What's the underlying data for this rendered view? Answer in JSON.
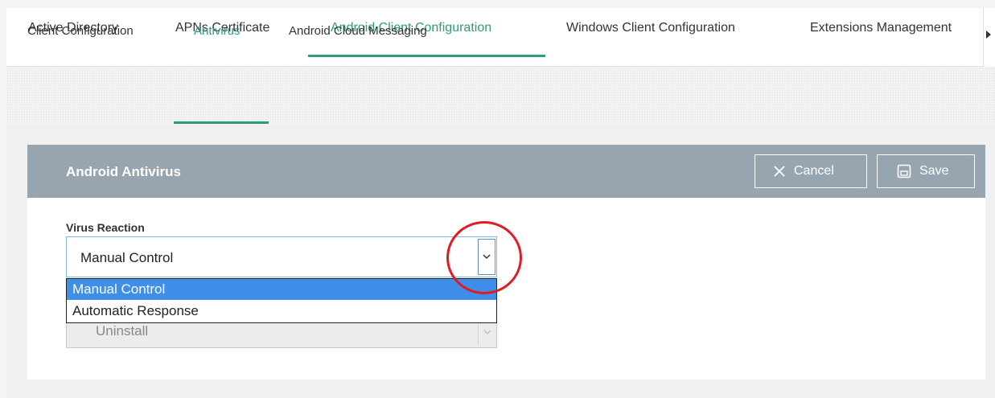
{
  "top_tabs": [
    {
      "label": "Active Directory"
    },
    {
      "label": "APNs Certificate"
    },
    {
      "label": "Android Client Configuration"
    },
    {
      "label": "Windows Client Configuration"
    },
    {
      "label": "Extensions Management"
    }
  ],
  "sub_tabs": [
    {
      "label": "Client Configuration"
    },
    {
      "label": "Antivirus"
    },
    {
      "label": "Android Cloud Messaging"
    }
  ],
  "panel": {
    "title": "Android Antivirus",
    "cancel_label": "Cancel",
    "save_label": "Save",
    "field_label": "Virus Reaction",
    "selected_value": "Manual Control",
    "options": [
      "Manual Control",
      "Automatic Response"
    ],
    "second_select_value": "Uninstall"
  },
  "colors": {
    "accent": "#2a9d7c",
    "header_bg": "#97a5b0",
    "selected_option": "#3f8ee9",
    "highlight": "#e11b22"
  }
}
